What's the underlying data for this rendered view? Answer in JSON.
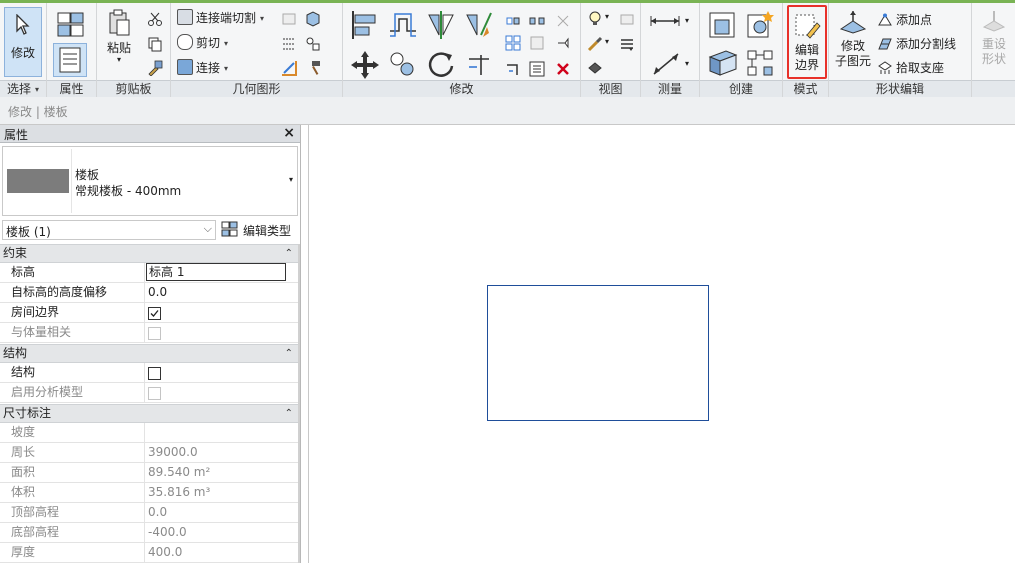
{
  "ribbon": {
    "panels": {
      "select": "选择",
      "properties": "属性",
      "clipboard": "剪贴板",
      "geometry": "几何图形",
      "modify": "修改",
      "view": "视图",
      "measure": "测量",
      "create": "创建",
      "mode": "模式",
      "shape_edit": "形状编辑"
    },
    "modify_button": "修改",
    "paste_button": "粘贴",
    "geometry": {
      "join_cut": "连接端切割",
      "cut": "剪切",
      "join": "连接"
    },
    "edit_boundary": [
      "编辑",
      "边界"
    ],
    "modify_subelements": [
      "修改",
      "子图元"
    ],
    "add_point": "添加点",
    "add_split_line": "添加分割线",
    "pick_supports": "拾取支座",
    "reset_shape": [
      "重设",
      "形状"
    ],
    "highlight_color": "#e8312a",
    "accent_color": "#79b354"
  },
  "options_bar": {
    "breadcrumb": "修改 | 楼板"
  },
  "properties": {
    "title": "属性",
    "family": "楼板",
    "type": "常规楼板 - 400mm",
    "instance_filter": "楼板 (1)",
    "edit_type": "编辑类型",
    "groups": {
      "constraints": "约束",
      "structure": "结构",
      "dimensions": "尺寸标注"
    },
    "rows": {
      "level": {
        "label": "标高",
        "value": "标高 1"
      },
      "height_offset": {
        "label": "自标高的高度偏移",
        "value": "0.0"
      },
      "room_bounding": {
        "label": "房间边界",
        "checked": true
      },
      "related_mass": {
        "label": "与体量相关",
        "checked": false
      },
      "structural": {
        "label": "结构",
        "checked": false
      },
      "analytical_model": {
        "label": "启用分析模型",
        "checked": false
      },
      "slope": {
        "label": "坡度",
        "value": ""
      },
      "perimeter": {
        "label": "周长",
        "value": "39000.0"
      },
      "area": {
        "label": "面积",
        "value": "89.540 m²"
      },
      "volume": {
        "label": "体积",
        "value": "35.816 m³"
      },
      "top_elevation": {
        "label": "顶部高程",
        "value": "0.0"
      },
      "bottom_elevation": {
        "label": "底部高程",
        "value": "-400.0"
      },
      "thickness": {
        "label": "厚度",
        "value": "400.0"
      }
    }
  },
  "canvas": {
    "slab_outline_color": "#1f4e9a"
  }
}
